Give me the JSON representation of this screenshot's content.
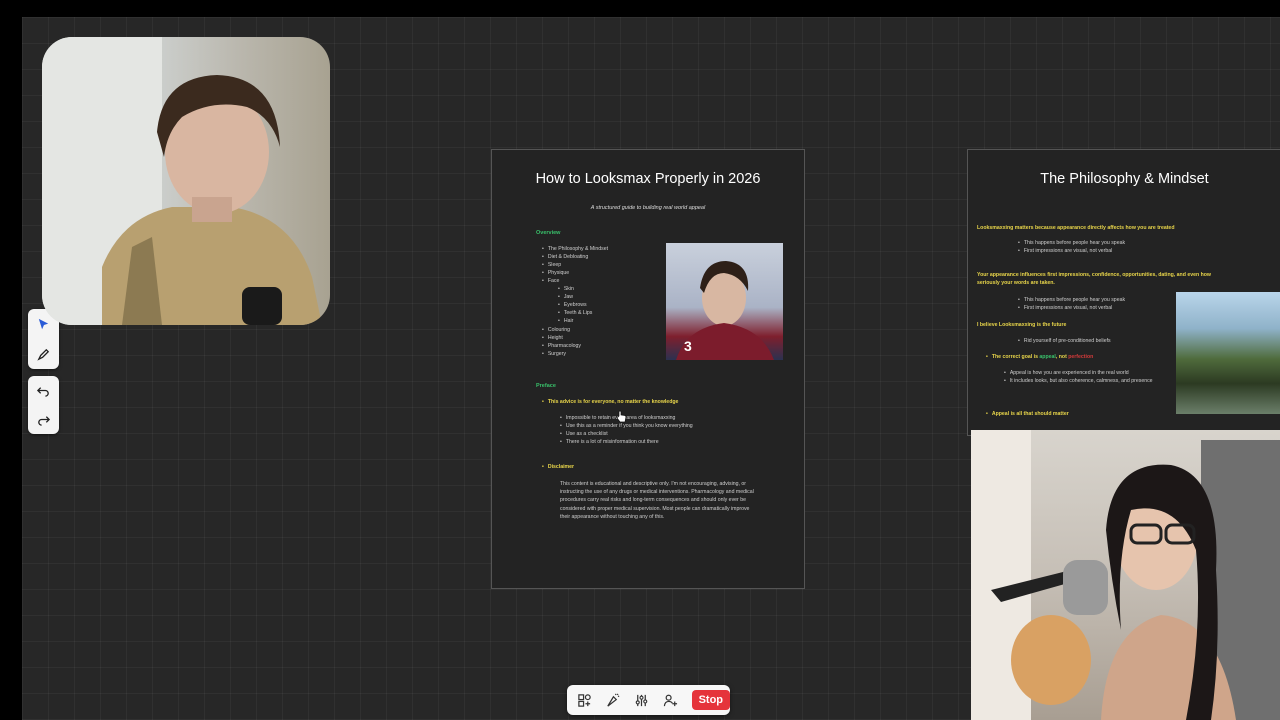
{
  "slides": {
    "main": {
      "title": "How to Looksmax Properly in 2026",
      "subtitle": "A structured guide to building real world appeal",
      "overview_heading": "Overview",
      "overview_items": [
        "The Philosophy & Mindset",
        "Diet & Debloating",
        "Sleep",
        "Physique",
        "Face"
      ],
      "face_subitems": [
        "Skin",
        "Jaw",
        "Eyebrows",
        "Teeth & Lips",
        "Hair"
      ],
      "overview_items_after": [
        "Colouring",
        "Height",
        "Pharmacology",
        "Surgery"
      ],
      "preface_heading": "Preface",
      "preface_point": "This advice is for everyone, no matter the knowledge",
      "preface_subitems": [
        "Impossible to retain every area of looksmaxxing",
        "Use this as a reminder if you think you know everything",
        "Use as a checklist",
        "There is a lot of misinformation out there"
      ],
      "disclaimer_heading": "Disclaimer",
      "disclaimer_text": "This content is educational and descriptive only. I'm not encouraging, advising, or instructing the use of any drugs or medical interventions. Pharmacology and medical procedures carry real risks and long-term consequences and should only ever be considered with proper medical supervision. Most people can dramatically improve their appearance without touching any of this."
    },
    "second": {
      "title": "The Philosophy & Mindset",
      "p1": "Looksmaxxing matters because appearance directly affects how you are treated",
      "p1_items": [
        "This happens before people hear you speak",
        "First impressions are visual, not verbal"
      ],
      "p2": "Your appearance influences first impressions, confidence, opportunities, dating, and even how seriously your words are taken.",
      "p2_items": [
        "This happens before people hear you speak",
        "First impressions are visual, not verbal"
      ],
      "p3": "I believe Looksmaxxing is the future",
      "p3_items": [
        "Rid yourself of pre-conditioned beliefs"
      ],
      "goal_prefix": "The correct goal is ",
      "goal_appeal": "appeal",
      "goal_mid": ", not ",
      "goal_not": "perfection",
      "goal_items": [
        "Appeal is how you are experienced in the real world",
        "It includes looks, but also coherence, calmness, and presence"
      ],
      "p4": "Appeal is all that should matter"
    }
  },
  "controlbar": {
    "stop_label": "Stop"
  },
  "icons": {
    "toolbar": [
      "pointer-icon",
      "pen-icon",
      "undo-icon",
      "redo-icon"
    ],
    "controlbar": [
      "add-shapes-icon",
      "effects-icon",
      "settings-sliders-icon",
      "add-person-icon"
    ]
  },
  "colors": {
    "accent_green": "#39c06a",
    "accent_yellow": "#e8d54a",
    "stop_red": "#e5343b",
    "tool_active": "#2a5bd7"
  }
}
